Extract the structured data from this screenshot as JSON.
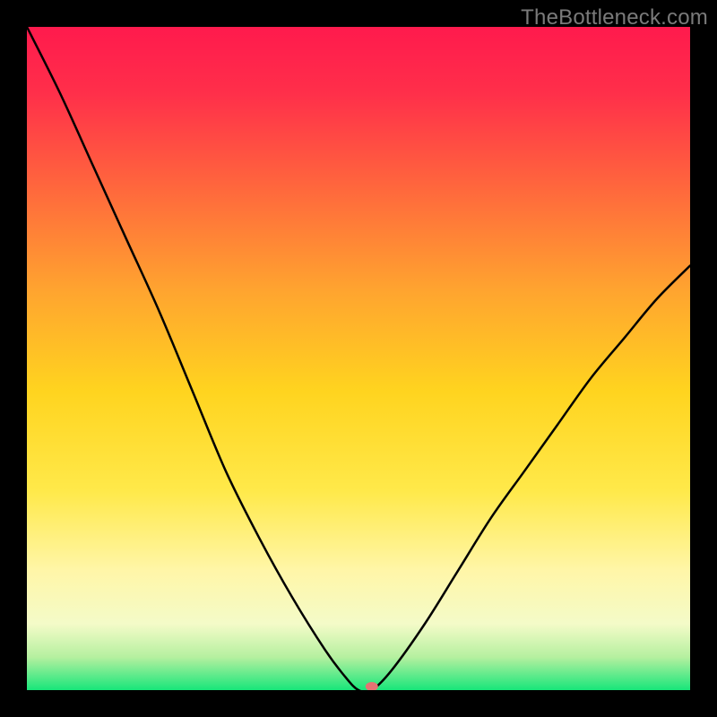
{
  "watermark": "TheBottleneck.com",
  "chart_data": {
    "type": "line",
    "title": "",
    "xlabel": "",
    "ylabel": "",
    "xlim": [
      0,
      100
    ],
    "ylim": [
      0,
      100
    ],
    "background_gradient": {
      "stops": [
        {
          "offset": 0.0,
          "color": "#ff1a4d"
        },
        {
          "offset": 0.1,
          "color": "#ff2f4a"
        },
        {
          "offset": 0.25,
          "color": "#ff6a3c"
        },
        {
          "offset": 0.4,
          "color": "#ffa52f"
        },
        {
          "offset": 0.55,
          "color": "#ffd41f"
        },
        {
          "offset": 0.7,
          "color": "#ffe94a"
        },
        {
          "offset": 0.82,
          "color": "#fff6a8"
        },
        {
          "offset": 0.9,
          "color": "#f4fbc8"
        },
        {
          "offset": 0.95,
          "color": "#b6f0a0"
        },
        {
          "offset": 1.0,
          "color": "#18e67a"
        }
      ]
    },
    "series": [
      {
        "name": "bottleneck-curve",
        "color": "#000000",
        "x": [
          0,
          5,
          10,
          15,
          20,
          25,
          30,
          35,
          40,
          45,
          48,
          50,
          52,
          55,
          60,
          65,
          70,
          75,
          80,
          85,
          90,
          95,
          100
        ],
        "y": [
          100,
          90,
          79,
          68,
          57,
          45,
          33,
          23,
          14,
          6,
          2,
          0,
          0,
          3,
          10,
          18,
          26,
          33,
          40,
          47,
          53,
          59,
          64
        ]
      }
    ],
    "marker": {
      "x": 52,
      "y": 0,
      "color": "#e57373"
    }
  }
}
